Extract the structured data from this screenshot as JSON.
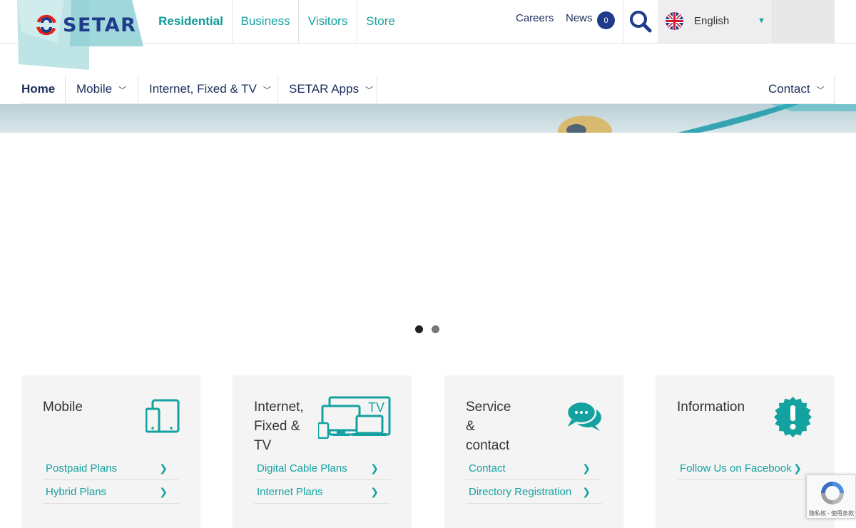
{
  "brand": {
    "logo_text": "SETAR",
    "primary_color": "#1f3b8a",
    "accent_color": "#13a2a0",
    "logo_red": "#e2231a"
  },
  "segments": [
    {
      "label": "Residential",
      "active": true
    },
    {
      "label": "Business",
      "active": false
    },
    {
      "label": "Visitors",
      "active": false
    },
    {
      "label": "Store",
      "active": false
    }
  ],
  "utility": {
    "careers_label": "Careers",
    "news_label": "News",
    "news_count": "0",
    "search_icon": "search-icon"
  },
  "language": {
    "label": "English",
    "flag_icon": "uk-flag-icon",
    "caret_icon": "caret-down-icon"
  },
  "main_nav": [
    {
      "label": "Home",
      "has_dropdown": false
    },
    {
      "label": "Mobile",
      "has_dropdown": true
    },
    {
      "label": "Internet, Fixed & TV",
      "has_dropdown": true
    },
    {
      "label": "SETAR Apps",
      "has_dropdown": true
    },
    {
      "label": "Contact",
      "has_dropdown": true
    }
  ],
  "slider": {
    "slides": 2,
    "active_index": 0
  },
  "cards": [
    {
      "title": "Mobile",
      "icon": "mobile-devices-icon",
      "links": [
        "Postpaid Plans",
        "Hybrid Plans"
      ]
    },
    {
      "title": "Internet,\nFixed &\nTV",
      "icon": "tv-devices-icon",
      "links": [
        "Digital Cable Plans",
        "Internet Plans"
      ]
    },
    {
      "title": "Service\n&\ncontact",
      "icon": "chat-bubbles-icon",
      "links": [
        "Contact",
        "Directory Registration"
      ]
    },
    {
      "title": "Information",
      "icon": "info-exclamation-icon",
      "links": [
        "Follow Us on Facebook"
      ]
    }
  ],
  "recaptcha": {
    "footer_text": "隐私权 - 使用条款",
    "icon": "recaptcha-icon"
  }
}
